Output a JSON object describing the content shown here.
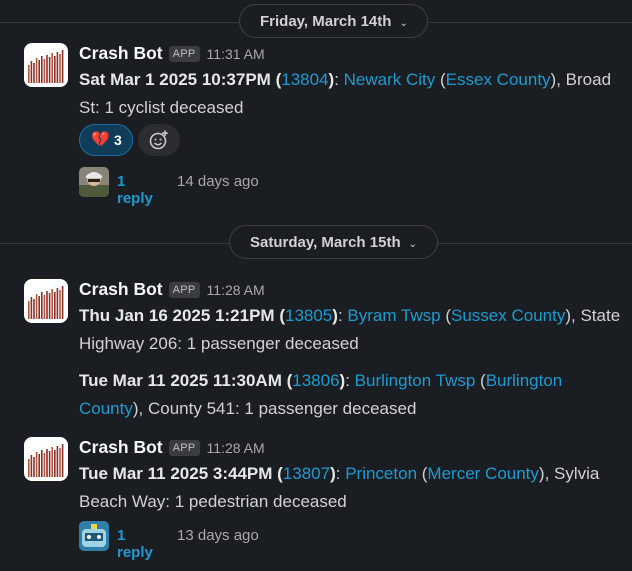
{
  "dividers": [
    {
      "label": "Friday, March 14th"
    },
    {
      "label": "Saturday, March 15th"
    }
  ],
  "messages": [
    {
      "sender": "Crash Bot",
      "badge": "APP",
      "time": "11:31 AM",
      "entries": [
        {
          "date": "Sat Mar 1 2025 10:37PM",
          "id": "13804",
          "place": "Newark City",
          "county": "Essex County",
          "detail": ", Broad St: 1 cyclist deceased"
        }
      ],
      "reaction": {
        "emoji": "broken-heart-icon",
        "count": "3"
      },
      "thread": {
        "reply": "1 reply",
        "ago": "14 days ago"
      }
    },
    {
      "sender": "Crash Bot",
      "badge": "APP",
      "time": "11:28 AM",
      "entries": [
        {
          "date": "Thu Jan 16 2025 1:21PM",
          "id": "13805",
          "place": "Byram Twsp",
          "county": "Sussex County",
          "detail": ", State Highway 206: 1 passenger deceased"
        },
        {
          "date": "Tue Mar 11 2025 11:30AM",
          "id": "13806",
          "place": "Burlington Twsp",
          "county": "Burlington County",
          "detail": ", County 541: 1 passenger deceased"
        }
      ]
    },
    {
      "sender": "Crash Bot",
      "badge": "APP",
      "time": "11:28 AM",
      "entries": [
        {
          "date": "Tue Mar 11 2025 3:44PM",
          "id": "13807",
          "place": "Princeton",
          "county": "Mercer County",
          "detail": ", Sylvia Beach Way: 1 pedestrian deceased"
        }
      ],
      "thread": {
        "reply": "1 reply",
        "ago": "13 days ago"
      }
    }
  ],
  "colors": {
    "link": "#1d9bd1",
    "background": "#1a1d21",
    "reaction_bg": "#103c5a"
  }
}
